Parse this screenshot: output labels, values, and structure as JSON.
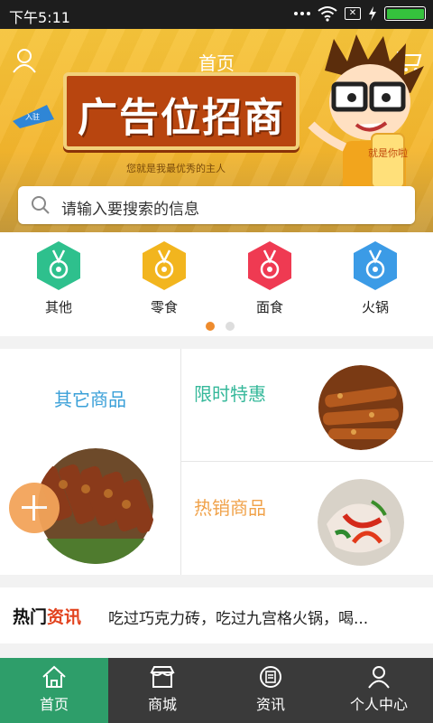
{
  "status_bar": {
    "time": "下午5:11"
  },
  "banner": {
    "home_title": "首页",
    "ad_main": "广告位招商",
    "ad_sub": "您就是我最优秀的主人",
    "kite_text": "入驻",
    "cartoon_sign": "就是你啦"
  },
  "search": {
    "placeholder": "请输入要搜索的信息"
  },
  "categories": [
    {
      "label": "其他",
      "color": "#2ec08d"
    },
    {
      "label": "零食",
      "color": "#f2b51e"
    },
    {
      "label": "面食",
      "color": "#ef3a52"
    },
    {
      "label": "火锅",
      "color": "#3b9be6"
    }
  ],
  "pager": {
    "pages": 2,
    "active": 1
  },
  "promo": {
    "other_goods": "其它商品",
    "limited_offer": "限时特惠",
    "hot_goods": "热销商品"
  },
  "news": {
    "tag_part1": "热门",
    "tag_part2": "资讯",
    "headline": "吃过巧克力砖，吃过九宫格火锅，喝..."
  },
  "tabbar": {
    "items": [
      {
        "label": "首页",
        "active": true
      },
      {
        "label": "商城",
        "active": false
      },
      {
        "label": "资讯",
        "active": false
      },
      {
        "label": "个人中心",
        "active": false
      }
    ]
  },
  "colors": {
    "accent": "#2e9e6a",
    "orange": "#ee8b2d"
  }
}
